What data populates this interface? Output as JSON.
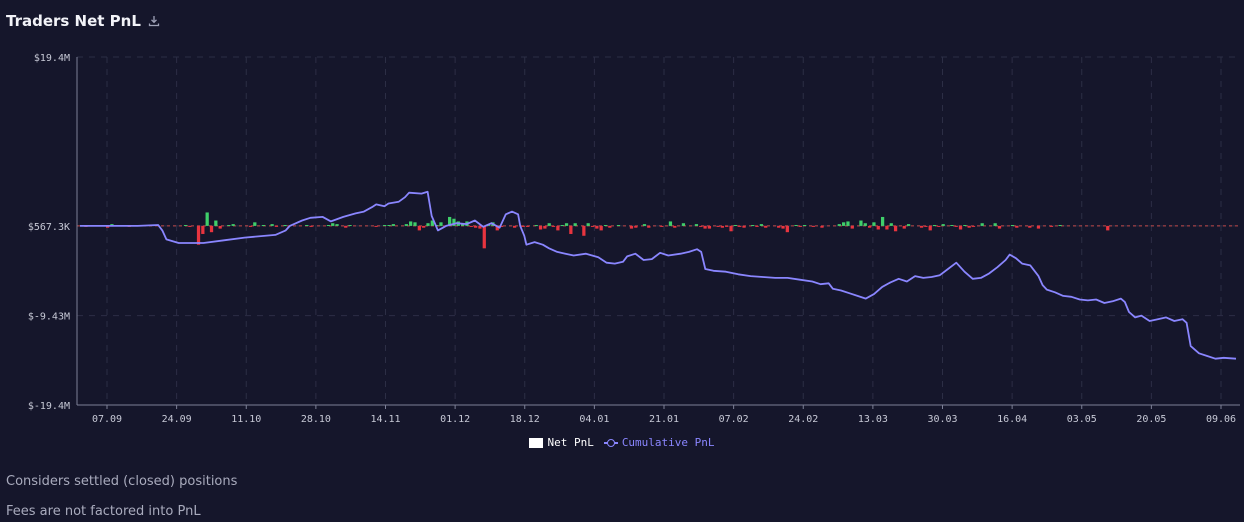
{
  "header": {
    "title": "Traders Net PnL",
    "download_icon": "download-icon"
  },
  "colors": {
    "background": "#15162b",
    "positive": "#3fcf6a",
    "negative": "#e8343f",
    "cumulative": "#8a86ff",
    "grid": "#2c2e45",
    "zero_line": "#c24a4a"
  },
  "chart_data": {
    "type": "bar",
    "title": "Traders Net PnL",
    "grid": true,
    "legend_placement": "bottom",
    "y_ticks": [
      "$19.4M",
      "$567.3K",
      "$-9.43M",
      "$-19.4M"
    ],
    "ylim": [
      -19.4,
      19.4
    ],
    "y_units": "$M",
    "x_tick_labels": [
      "07.09",
      "24.09",
      "11.10",
      "28.10",
      "14.11",
      "01.12",
      "18.12",
      "04.01",
      "21.01",
      "07.02",
      "24.02",
      "13.03",
      "30.03",
      "16.04",
      "03.05",
      "20.05",
      "09.06"
    ],
    "legend": [
      {
        "label": "Net PnL",
        "marker": "square",
        "color": "#ffffff"
      },
      {
        "label": "Cumulative PnL",
        "marker": "line-circle",
        "color": "#8a86ff"
      }
    ],
    "series": [
      {
        "name": "Net PnL",
        "kind": "bar",
        "values": [
          0,
          -0.1,
          0,
          0.1,
          0,
          0,
          -0.2,
          0.2,
          0,
          0,
          0,
          -0.1,
          0,
          0,
          0,
          0,
          0,
          0,
          0,
          0,
          0,
          0,
          0,
          0,
          0.1,
          -0.1,
          0,
          -2.1,
          -0.9,
          1.5,
          -0.7,
          0.6,
          -0.3,
          0,
          0.1,
          0.2,
          0,
          0,
          0,
          -0.1,
          0.4,
          0,
          0.1,
          0,
          0.2,
          -0.1,
          0,
          0.1,
          0,
          0,
          0,
          0,
          0.1,
          -0.1,
          0,
          0,
          0,
          0.1,
          0.3,
          0.2,
          0,
          -0.2,
          0.1,
          0,
          0,
          0,
          0,
          0,
          -0.1,
          0,
          0.1,
          0.1,
          0.2,
          0,
          0,
          0.2,
          0.5,
          0.4,
          -0.5,
          -0.2,
          0.3,
          0.6,
          0.1,
          0.4,
          0,
          1,
          0.8,
          0.5,
          0.3,
          0.5,
          -0.1,
          -0.2,
          -0.3,
          -2.5,
          0.2,
          0.4,
          -0.5,
          -0.1,
          0,
          0,
          -0.2,
          0,
          -0.1,
          -0.1,
          0,
          0.1,
          -0.4,
          -0.3,
          0.3,
          -0.1,
          -0.5,
          0.1,
          0.3,
          -0.9,
          0.3,
          0,
          -1.1,
          0.3,
          -0.1,
          -0.3,
          -0.5,
          0.1,
          -0.2,
          0,
          0.1,
          0,
          0,
          -0.3,
          -0.2,
          0,
          0.2,
          -0.2,
          0,
          0,
          -0.1,
          0,
          0.5,
          -0.2,
          0,
          0.3,
          0,
          0,
          0.2,
          -0.1,
          -0.3,
          -0.3,
          0,
          -0.1,
          -0.2,
          -0.1,
          -0.6,
          0.1,
          -0.1,
          -0.2,
          0,
          0.1,
          -0.1,
          0.2,
          -0.2,
          0,
          0,
          -0.2,
          -0.3,
          -0.7,
          0,
          0.1,
          -0.1,
          0.1,
          0,
          -0.1,
          0,
          -0.2,
          0,
          0,
          0,
          0.2,
          0.4,
          0.5,
          -0.3,
          0,
          0.6,
          0.3,
          -0.2,
          0.4,
          -0.4,
          1,
          -0.4,
          0.3,
          -0.6,
          0,
          -0.3,
          0.2,
          0,
          0,
          -0.2,
          -0.1,
          -0.5,
          0.1,
          -0.1,
          0.2,
          0,
          0.1,
          -0.1,
          -0.4,
          0.1,
          -0.2,
          -0.1,
          0,
          0.3,
          0,
          0,
          0.3,
          -0.3,
          0,
          0,
          0.1,
          -0.2,
          0,
          0,
          -0.2,
          0,
          -0.3,
          0,
          0,
          -0.1,
          0,
          0.1,
          0,
          0,
          0,
          0,
          0,
          0,
          0,
          0,
          0,
          0,
          -0.5,
          0,
          0,
          0,
          0,
          0,
          0,
          0,
          0,
          0,
          0,
          0,
          0,
          0,
          0,
          0,
          0,
          0,
          0,
          0,
          0,
          0,
          0,
          0,
          0,
          0,
          0,
          0,
          0,
          0
        ]
      },
      {
        "name": "Cumulative PnL",
        "kind": "line",
        "points": [
          [
            0,
            0
          ],
          [
            28,
            0
          ],
          [
            38,
            0.1
          ],
          [
            40,
            -0.5
          ],
          [
            42,
            -1.5
          ],
          [
            48,
            -1.9
          ],
          [
            60,
            -1.9
          ],
          [
            70,
            -1.6
          ],
          [
            80,
            -1.3
          ],
          [
            95,
            -1.0
          ],
          [
            100,
            -0.5
          ],
          [
            102,
            0
          ],
          [
            108,
            0.6
          ],
          [
            112,
            0.9
          ],
          [
            118,
            1
          ],
          [
            122,
            0.5
          ],
          [
            128,
            1
          ],
          [
            134,
            1.4
          ],
          [
            138,
            1.6
          ],
          [
            142,
            2.1
          ],
          [
            144,
            2.4
          ],
          [
            148,
            2.2
          ],
          [
            150,
            2.5
          ],
          [
            155,
            2.7
          ],
          [
            158,
            3.2
          ],
          [
            160,
            3.7
          ],
          [
            166,
            3.6
          ],
          [
            169,
            3.8
          ],
          [
            171,
            1.1
          ],
          [
            174,
            -0.5
          ],
          [
            178,
            0
          ],
          [
            183,
            0.3
          ],
          [
            188,
            0.2
          ],
          [
            192,
            0.6
          ],
          [
            196,
            -0.1
          ],
          [
            200,
            0.3
          ],
          [
            204,
            -0.2
          ],
          [
            207,
            1.3
          ],
          [
            210,
            1.6
          ],
          [
            213,
            1.3
          ],
          [
            214,
            0
          ],
          [
            216,
            -1.1
          ],
          [
            217,
            -2.1
          ],
          [
            221,
            -1.8
          ],
          [
            225,
            -2.1
          ],
          [
            228,
            -2.5
          ],
          [
            232,
            -2.9
          ],
          [
            236,
            -3.1
          ],
          [
            240,
            -3.3
          ],
          [
            246,
            -3.1
          ],
          [
            252,
            -3.5
          ],
          [
            256,
            -4.1
          ],
          [
            260,
            -4.2
          ],
          [
            264,
            -4.0
          ],
          [
            266,
            -3.4
          ],
          [
            270,
            -3.1
          ],
          [
            274,
            -3.8
          ],
          [
            278,
            -3.7
          ],
          [
            282,
            -3.0
          ],
          [
            286,
            -3.3
          ],
          [
            292,
            -3.1
          ],
          [
            296,
            -2.9
          ],
          [
            300,
            -2.6
          ],
          [
            302,
            -2.9
          ],
          [
            304,
            -4.8
          ],
          [
            308,
            -5.0
          ],
          [
            314,
            -5.1
          ],
          [
            320,
            -5.4
          ],
          [
            326,
            -5.6
          ],
          [
            332,
            -5.7
          ],
          [
            338,
            -5.8
          ],
          [
            344,
            -5.8
          ],
          [
            350,
            -6.0
          ],
          [
            356,
            -6.2
          ],
          [
            360,
            -6.5
          ],
          [
            364,
            -6.4
          ],
          [
            366,
            -7.0
          ],
          [
            370,
            -7.2
          ],
          [
            374,
            -7.5
          ],
          [
            378,
            -7.8
          ],
          [
            382,
            -8.1
          ],
          [
            386,
            -7.6
          ],
          [
            390,
            -6.8
          ],
          [
            394,
            -6.3
          ],
          [
            398,
            -5.9
          ],
          [
            402,
            -6.2
          ],
          [
            406,
            -5.6
          ],
          [
            410,
            -5.8
          ],
          [
            414,
            -5.7
          ],
          [
            418,
            -5.5
          ],
          [
            422,
            -4.8
          ],
          [
            426,
            -4.1
          ],
          [
            430,
            -5.1
          ],
          [
            434,
            -5.9
          ],
          [
            438,
            -5.8
          ],
          [
            442,
            -5.3
          ],
          [
            446,
            -4.6
          ],
          [
            450,
            -3.8
          ],
          [
            452,
            -3.2
          ],
          [
            455,
            -3.6
          ],
          [
            458,
            -4.2
          ],
          [
            462,
            -4.4
          ],
          [
            466,
            -5.6
          ],
          [
            468,
            -6.6
          ],
          [
            470,
            -7.1
          ],
          [
            474,
            -7.4
          ],
          [
            478,
            -7.8
          ],
          [
            482,
            -7.9
          ],
          [
            486,
            -8.2
          ],
          [
            490,
            -8.3
          ],
          [
            494,
            -8.2
          ],
          [
            498,
            -8.6
          ],
          [
            502,
            -8.4
          ],
          [
            506,
            -8.1
          ],
          [
            508,
            -8.5
          ],
          [
            510,
            -9.6
          ],
          [
            513,
            -10.2
          ],
          [
            516,
            -10.0
          ],
          [
            520,
            -10.6
          ],
          [
            524,
            -10.4
          ],
          [
            528,
            -10.2
          ],
          [
            532,
            -10.6
          ],
          [
            536,
            -10.4
          ],
          [
            538,
            -10.8
          ],
          [
            540,
            -13.4
          ],
          [
            544,
            -14.2
          ],
          [
            548,
            -14.5
          ],
          [
            552,
            -14.8
          ],
          [
            556,
            -14.7
          ],
          [
            562,
            -14.8
          ]
        ]
      }
    ]
  },
  "notes": {
    "note1": "Considers settled (closed) positions",
    "note2": "Fees are not factored into PnL"
  }
}
